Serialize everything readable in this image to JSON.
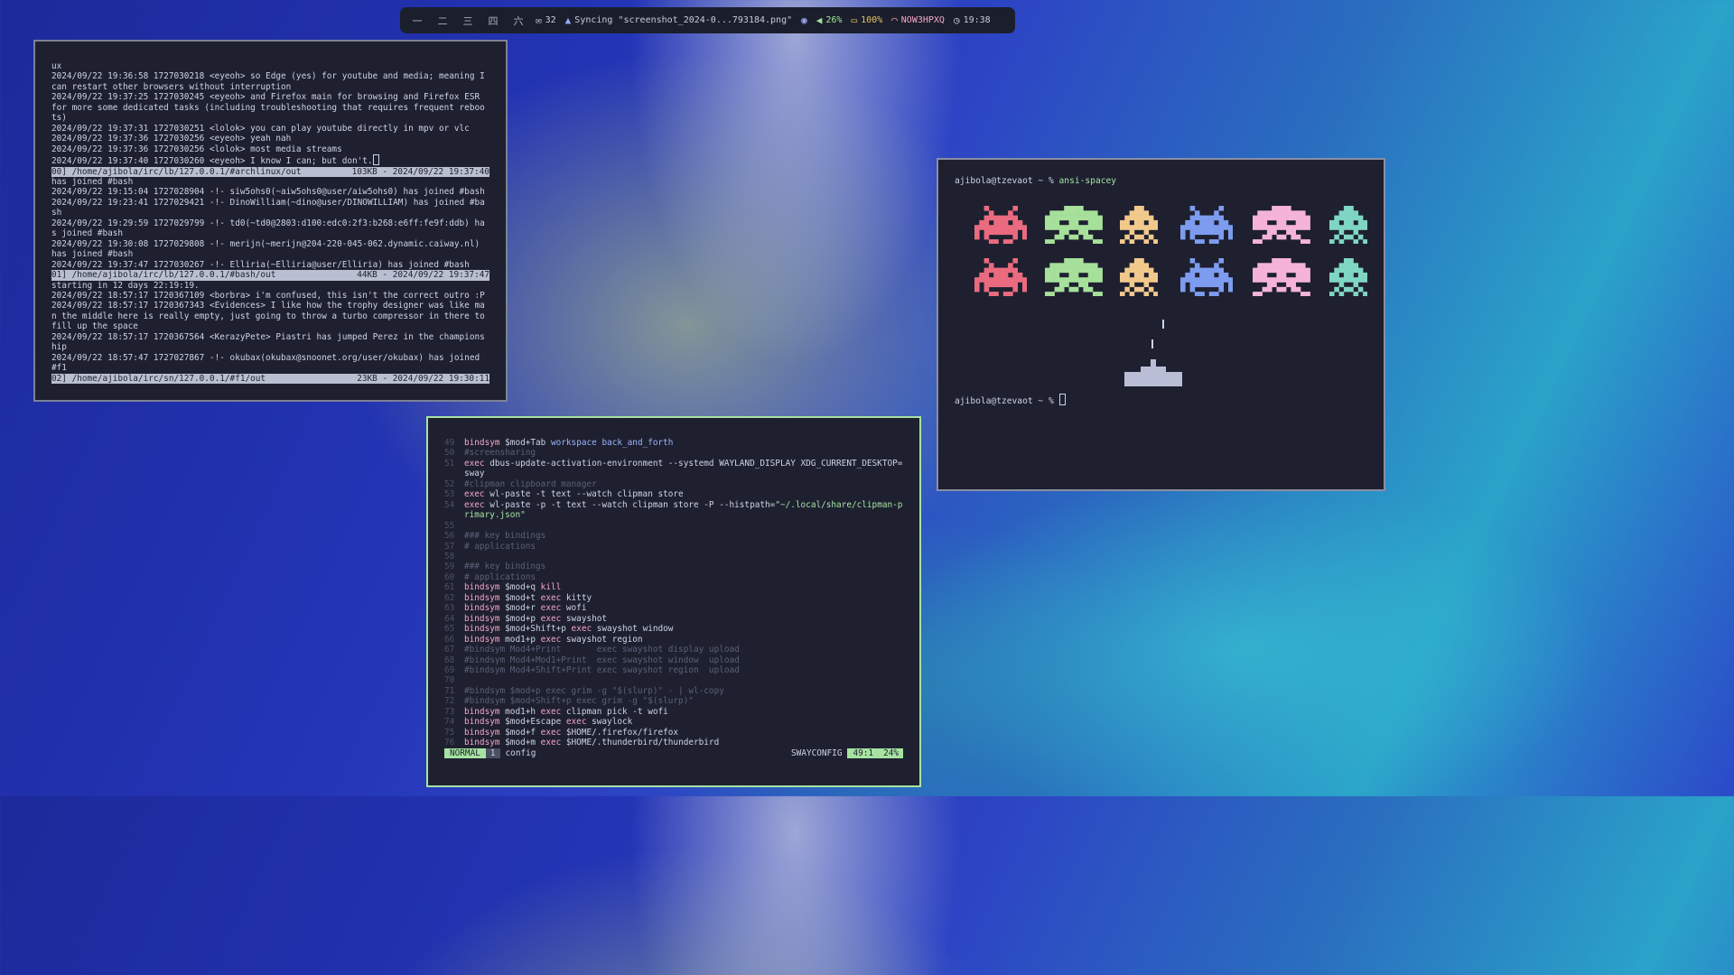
{
  "statusbar": {
    "workspaces": [
      "一",
      "二",
      "三",
      "四",
      "六"
    ],
    "mail_count": "32",
    "sync_text": "Syncing \"screenshot_2024-0...793184.png\"",
    "volume": "26%",
    "battery": "100%",
    "wifi": "NOW3HPXQ",
    "clock": "19:38",
    "icons": [
      "mail-icon",
      "sync-icon",
      "privacy-eye-icon",
      "volume-icon",
      "battery-icon",
      "wifi-icon",
      "clock-icon"
    ]
  },
  "irc": {
    "lines": [
      {
        "text": "ux"
      },
      {
        "text": "2024/09/22 19:36:58 1727030218 <eyeoh> so Edge (yes) for youtube and media; meaning I can restart other browsers without interruption"
      },
      {
        "text": "2024/09/22 19:37:25 1727030245 <eyeoh> and Firefox main for browsing and Firefox ESR for more some dedicated tasks (including troubleshooting that requires frequent reboots)"
      },
      {
        "text": "2024/09/22 19:37:31 1727030251 <lolok> you can play youtube directly in mpv or vlc"
      },
      {
        "text": "2024/09/22 19:37:36 1727030256 <eyeoh> yeah nah"
      },
      {
        "text": "2024/09/22 19:37:36 1727030256 <lolok> most media streams"
      },
      {
        "text": "2024/09/22 19:37:40 1727030260 <eyeoh> I know I can; but don't.",
        "cursor": true
      },
      {
        "status_left": "00] /home/ajibola/irc/lb/127.0.0.1/#archlinux/out",
        "status_right": "103KB - 2024/09/22 19:37:40"
      },
      {
        "text": "has joined #bash"
      },
      {
        "text": "2024/09/22 19:15:04 1727028904 -!- siw5ohs0(~aiw5ohs0@user/aiw5ohs0) has joined #bash"
      },
      {
        "text": "2024/09/22 19:23:41 1727029421 -!- DinoWilliam(~dino@user/DINOWILLIAM) has joined #bash"
      },
      {
        "text": "2024/09/22 19:29:59 1727029799 -!- td0(~td0@2803:d100:edc0:2f3:b268:e6ff:fe9f:ddb) has joined #bash"
      },
      {
        "text": "2024/09/22 19:30:08 1727029808 -!- merijn(~merijn@204-220-045-062.dynamic.caiway.nl) has joined #bash"
      },
      {
        "text": "2024/09/22 19:37:47 1727030267 -!- Elliria(~Elliria@user/Elliria) has joined #bash"
      },
      {
        "status_left": "01] /home/ajibola/irc/lb/127.0.0.1/#bash/out",
        "status_right": "44KB - 2024/09/22 19:37:47"
      },
      {
        "text": "starting in 12 days 22:19:19."
      },
      {
        "text": "2024/09/22 18:57:17 1720367109 <borbra> i'm confused, this isn't the correct outro :P"
      },
      {
        "text": "2024/09/22 18:57:17 1720367343 <Evidences> I like how the trophy designer was like man the middle here is really empty, just going to throw a turbo compressor in there to fill up the space"
      },
      {
        "text": "2024/09/22 18:57:17 1720367564 <KerazyPete> Piastri has jumped Perez in the championship"
      },
      {
        "text": "2024/09/22 18:57:47 1727027867 -!- okubax(okubax@snoonet.org/user/okubax) has joined #f1"
      },
      {
        "status_left": "02] /home/ajibola/irc/sn/127.0.0.1/#f1/out",
        "status_right": "23KB - 2024/09/22 19:30:11"
      }
    ]
  },
  "vim": {
    "lines": [
      {
        "n": "49",
        "parts": [
          [
            "kw",
            "bindsym"
          ],
          [
            "t",
            " $mod+Tab "
          ],
          [
            "vr",
            "workspace"
          ],
          [
            "t",
            " "
          ],
          [
            "vr",
            "back_and_forth"
          ]
        ]
      },
      {
        "n": "50",
        "parts": [
          [
            "cm",
            "#screensharing"
          ]
        ]
      },
      {
        "n": "51",
        "parts": [
          [
            "kw",
            "exec"
          ],
          [
            "t",
            " dbus-update-activation-environment --systemd WAYLAND_DISPLAY XDG_CURRENT_DESKTOP=sway"
          ]
        ]
      },
      {
        "n": "52",
        "parts": [
          [
            "cm",
            "#clipman clipboard manager"
          ]
        ]
      },
      {
        "n": "53",
        "parts": [
          [
            "kw",
            "exec"
          ],
          [
            "t",
            " wl-paste -t text --watch clipman store"
          ]
        ]
      },
      {
        "n": "54",
        "parts": [
          [
            "kw",
            "exec"
          ],
          [
            "t",
            " wl-paste -p -t text --watch clipman store -P --histpath="
          ],
          [
            "sr",
            "\"~/.local/share/clipman-primary.json\""
          ]
        ]
      },
      {
        "n": "55",
        "parts": []
      },
      {
        "n": "56",
        "parts": [
          [
            "cm",
            "### key bindings"
          ]
        ]
      },
      {
        "n": "57",
        "parts": [
          [
            "cm",
            "# applications"
          ]
        ]
      },
      {
        "n": "58",
        "parts": []
      },
      {
        "n": "59",
        "parts": [
          [
            "cm",
            "### key bindings"
          ]
        ]
      },
      {
        "n": "60",
        "parts": [
          [
            "cm",
            "# applications"
          ]
        ]
      },
      {
        "n": "61",
        "parts": [
          [
            "kw",
            "bindsym"
          ],
          [
            "t",
            " $mod+q "
          ],
          [
            "kw",
            "kill"
          ]
        ]
      },
      {
        "n": "62",
        "parts": [
          [
            "kw",
            "bindsym"
          ],
          [
            "t",
            " $mod+t "
          ],
          [
            "kw",
            "exec"
          ],
          [
            "t",
            " kitty"
          ]
        ]
      },
      {
        "n": "63",
        "parts": [
          [
            "kw",
            "bindsym"
          ],
          [
            "t",
            " $mod+r "
          ],
          [
            "kw",
            "exec"
          ],
          [
            "t",
            " wofi"
          ]
        ]
      },
      {
        "n": "64",
        "parts": [
          [
            "kw",
            "bindsym"
          ],
          [
            "t",
            " $mod+p "
          ],
          [
            "kw",
            "exec"
          ],
          [
            "t",
            " swayshot"
          ]
        ]
      },
      {
        "n": "65",
        "parts": [
          [
            "kw",
            "bindsym"
          ],
          [
            "t",
            " $mod+Shift+p "
          ],
          [
            "kw",
            "exec"
          ],
          [
            "t",
            " swayshot window"
          ]
        ]
      },
      {
        "n": "66",
        "parts": [
          [
            "kw",
            "bindsym"
          ],
          [
            "t",
            " mod1+p "
          ],
          [
            "kw",
            "exec"
          ],
          [
            "t",
            " swayshot region"
          ]
        ]
      },
      {
        "n": "67",
        "parts": [
          [
            "cm",
            "#bindsym Mod4+Print       exec swayshot display upload"
          ]
        ]
      },
      {
        "n": "68",
        "parts": [
          [
            "cm",
            "#bindsym Mod4+Mod1+Print  exec swayshot window  upload"
          ]
        ]
      },
      {
        "n": "69",
        "parts": [
          [
            "cm",
            "#bindsym Mod4+Shift+Print exec swayshot region  upload"
          ]
        ]
      },
      {
        "n": "70",
        "parts": []
      },
      {
        "n": "71",
        "parts": [
          [
            "cm",
            "#bindsym $mod+p exec grim -g \"$(slurp)\" - | wl-copy"
          ]
        ]
      },
      {
        "n": "72",
        "parts": [
          [
            "cm",
            "#bindsym $mod+Shift+p exec grim -g \"$(slurp)\""
          ]
        ]
      },
      {
        "n": "73",
        "parts": [
          [
            "kw",
            "bindsym"
          ],
          [
            "t",
            " mod1+h "
          ],
          [
            "kw",
            "exec"
          ],
          [
            "t",
            " clipman pick -t wofi"
          ]
        ]
      },
      {
        "n": "74",
        "parts": [
          [
            "kw",
            "bindsym"
          ],
          [
            "t",
            " $mod+Escape "
          ],
          [
            "kw",
            "exec"
          ],
          [
            "t",
            " swaylock"
          ]
        ]
      },
      {
        "n": "75",
        "parts": [
          [
            "kw",
            "bindsym"
          ],
          [
            "t",
            " $mod+f "
          ],
          [
            "kw",
            "exec"
          ],
          [
            "t",
            " $HOME/.firefox/firefox"
          ]
        ]
      },
      {
        "n": "76",
        "parts": [
          [
            "kw",
            "bindsym"
          ],
          [
            "t",
            " $mod+m "
          ],
          [
            "kw",
            "exec"
          ],
          [
            "t",
            " $HOME/.thunderbird/thunderbird"
          ]
        ]
      }
    ],
    "statusline": {
      "mode": "NORMAL",
      "buffer": "1",
      "filename": "config",
      "filetype": "SWAYCONFIG",
      "position": "49:1",
      "percent": "24%"
    }
  },
  "term": {
    "prompt1": "ajibola@tzevaot ~ % ",
    "command": "ansi-spacey",
    "prompt2": "ajibola@tzevaot ~ % ",
    "invader_colors": [
      "#ea6b7f",
      "#a6e09a",
      "#f2c98c",
      "#7d9cf0",
      "#f5b3d8",
      "#7fd6c2"
    ]
  }
}
